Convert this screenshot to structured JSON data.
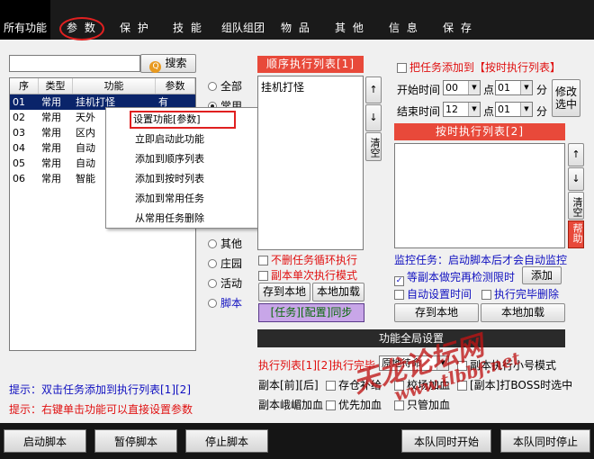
{
  "tabs": [
    {
      "label": "所有功能",
      "active": true
    },
    {
      "label": "参 数"
    },
    {
      "label": "保 护"
    },
    {
      "label": "技 能"
    },
    {
      "label": "组队组团"
    },
    {
      "label": "物 品"
    },
    {
      "label": "其 他"
    },
    {
      "label": "信 息"
    },
    {
      "label": "保 存"
    }
  ],
  "search": {
    "value": "",
    "button_label": "搜索",
    "icon": "magnifier-icon"
  },
  "task_table": {
    "headers": [
      "序",
      "类型",
      "功能",
      "参数"
    ],
    "rows": [
      {
        "id": "01",
        "type": "常用",
        "name": "挂机打怪",
        "param": "有",
        "selected": true
      },
      {
        "id": "02",
        "type": "常用",
        "name": "天外",
        "param": ""
      },
      {
        "id": "03",
        "type": "常用",
        "name": "区内",
        "param": ""
      },
      {
        "id": "04",
        "type": "常用",
        "name": "自动",
        "param": ""
      },
      {
        "id": "05",
        "type": "常用",
        "name": "自动",
        "param": ""
      },
      {
        "id": "06",
        "type": "常用",
        "name": "智能",
        "param": ""
      }
    ]
  },
  "context_menu": {
    "items": [
      "设置功能[参数]",
      "立即启动此功能",
      "添加到顺序列表",
      "添加到按时列表",
      "添加到常用任务",
      "从常用任务删除"
    ],
    "highlighted_index": 0
  },
  "category_radios": {
    "items": [
      "全部",
      "常用",
      "其他",
      "庄园",
      "活动",
      "脚本"
    ],
    "selected": "常用"
  },
  "hints": [
    "提示：双击任务添加到执行列表[1][2]",
    "提示：右键单击功能可以直接设置参数"
  ],
  "sequence_list": {
    "title": "顺序执行列表[1]",
    "items": [
      "挂机打怪"
    ],
    "up": "↑",
    "down": "↓",
    "clear": "清空",
    "no_delete_loop_label": "不删任务循环执行",
    "single_run_label": "副本单次执行模式",
    "save_local": "存到本地",
    "load_local": "本地加载",
    "sync_label": "[任务][配置]同步"
  },
  "timed": {
    "add_to_timed_label": "把任务添加到【按时执行列表】",
    "start_label": "开始时间",
    "start_hour": "00",
    "start_min": "01",
    "end_label": "结束时间",
    "end_hour": "12",
    "end_min": "01",
    "hour_unit": "点",
    "min_unit": "分",
    "modify_button": "修改选中",
    "list_title": "按时执行列表[2]",
    "up": "↑",
    "down": "↓",
    "clear": "清空",
    "help": "帮助"
  },
  "monitor": {
    "info": "监控任务：启动脚本后才会自动监控",
    "check_cd_label": "等副本做完再检测限时",
    "check_cd_checked": true,
    "add_button": "添加",
    "auto_time_label": "自动设置时间",
    "delete_after_label": "执行完毕删除",
    "save_local": "存到本地",
    "load_local": "本地加载"
  },
  "global_settings": {
    "title": "功能全局设置",
    "after_complete_label": "执行列表[1][2]执行完毕",
    "after_complete_value": "原地待命",
    "row1_right": "副本执行小号模式",
    "row2_left": "副本[前][后]",
    "row2_c1": "存仓补给",
    "row2_c2": "校场加血",
    "row2_right": "[副本]打BOSS时选中",
    "row3_left": "副本峨嵋加血",
    "row3_c1": "优先加血",
    "row3_c2": "只管加血"
  },
  "bottom_buttons": [
    "启动脚本",
    "暂停脚本",
    "停止脚本",
    "本队同时开始",
    "本队同时停止"
  ],
  "watermark": {
    "main": "天龙论坛网",
    "url": "www.tlbbf.net"
  },
  "colors": {
    "accent_red": "#e8493a",
    "tab_bar": "#1a1a1a",
    "selection": "#0a246a"
  }
}
